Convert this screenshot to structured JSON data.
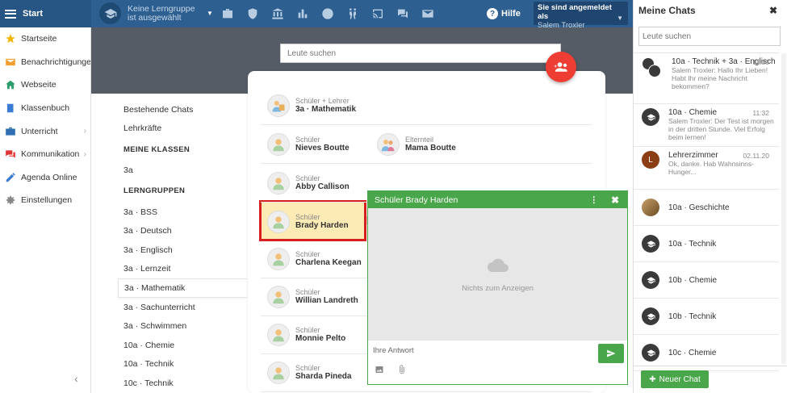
{
  "topbar": {
    "start_label": "Start",
    "group_label": "Keine Lerngruppe ist ausgewählt",
    "help_label": "Hilfe",
    "login_title": "Sie sind angemeldet als",
    "login_user": "Salem Troxler",
    "icons": [
      "briefcase-icon",
      "shield-icon",
      "institution-icon",
      "chart-icon",
      "gauge-icon",
      "people-walking-icon",
      "cast-icon",
      "comments-icon",
      "envelope-icon"
    ]
  },
  "sidebar": {
    "items": [
      {
        "label": "Startseite",
        "icon": "star-icon",
        "color": "#f0b400"
      },
      {
        "label": "Benachrichtigungen",
        "icon": "envelope-icon",
        "color": "#f0a030"
      },
      {
        "label": "Webseite",
        "icon": "home-icon",
        "color": "#2a9d6a"
      },
      {
        "label": "Klassenbuch",
        "icon": "book-icon",
        "color": "#3a7bd5"
      },
      {
        "label": "Unterricht",
        "icon": "briefcase-icon",
        "color": "#2d6fb0",
        "chevron": true
      },
      {
        "label": "Kommunikation",
        "icon": "chat-icon",
        "color": "#d33",
        "chevron": true
      },
      {
        "label": "Agenda Online",
        "icon": "pencil-icon",
        "color": "#3a7bd5"
      },
      {
        "label": "Einstellungen",
        "icon": "gear-icon",
        "color": "#888"
      }
    ]
  },
  "search": {
    "placeholder": "Leute suchen"
  },
  "left_list": {
    "existing_chats": "Bestehende Chats",
    "teachers": "Lehrkräfte",
    "my_classes_head": "MEINE KLASSEN",
    "classes": [
      "3a"
    ],
    "groups_head": "LERNGRUPPEN",
    "groups": [
      "3a · BSS",
      "3a · Deutsch",
      "3a · Englisch",
      "3a · Lernzeit",
      "3a · Mathematik",
      "3a · Sachunterricht",
      "3a · Schwimmen",
      "10a · Chemie",
      "10a · Technik",
      "10c · Technik"
    ],
    "active_group": "3a · Mathematik"
  },
  "people": [
    [
      {
        "role": "Schüler + Lehrer",
        "name": "3a · Mathematik"
      }
    ],
    [
      {
        "role": "Schüler",
        "name": "Nieves Boutte"
      },
      {
        "role": "Elternteil",
        "name": "Mama Boutte"
      }
    ],
    [
      {
        "role": "Schüler",
        "name": "Abby Callison"
      }
    ],
    [
      {
        "role": "Schüler",
        "name": "Brady Harden"
      }
    ],
    [
      {
        "role": "Schüler",
        "name": "Charlena Keegan"
      }
    ],
    [
      {
        "role": "Schüler",
        "name": "Willian Landreth"
      }
    ],
    [
      {
        "role": "Schüler",
        "name": "Monnie Pelto"
      }
    ],
    [
      {
        "role": "Schüler",
        "name": "Sharda Pineda"
      }
    ]
  ],
  "chat_window": {
    "title": "Schüler Brady Harden",
    "empty_text": "Nichts zum Anzeigen",
    "reply_placeholder": "Ihre Antwort"
  },
  "chat_panel": {
    "title": "Meine Chats",
    "search_placeholder": "Leute suchen",
    "new_chat_label": "Neuer Chat",
    "chats": [
      {
        "title": "10a · Technik + 3a · Englisch",
        "message": "Salem Troxler: Hallo Ihr Lieben! Habt Ihr meine Nachricht bekommen?",
        "time": "11:33",
        "avatar": "double"
      },
      {
        "title": "10a · Chemie",
        "message": "Salem Troxler: Der Test ist morgen in der dritten Stunde. Viel Erfolg beim lernen!",
        "time": "11:32",
        "avatar": "cap"
      },
      {
        "title": "Lehrerzimmer",
        "message": "Ok, danke. Hab Wahnsinns-Hunger...",
        "time": "02.11.20",
        "avatar": "letter",
        "letter": "L"
      },
      {
        "title": "10a · Geschichte",
        "message": "",
        "time": "",
        "avatar": "photo"
      },
      {
        "title": "10a · Technik",
        "message": "",
        "time": "",
        "avatar": "cap"
      },
      {
        "title": "10b · Chemie",
        "message": "",
        "time": "",
        "avatar": "cap"
      },
      {
        "title": "10b · Technik",
        "message": "",
        "time": "",
        "avatar": "cap"
      },
      {
        "title": "10c · Chemie",
        "message": "",
        "time": "",
        "avatar": "cap"
      }
    ]
  },
  "colors": {
    "primary": "#2d5f91",
    "green": "#4aa64a",
    "fab_red": "#ee3d32",
    "highlight": "#d62020"
  }
}
